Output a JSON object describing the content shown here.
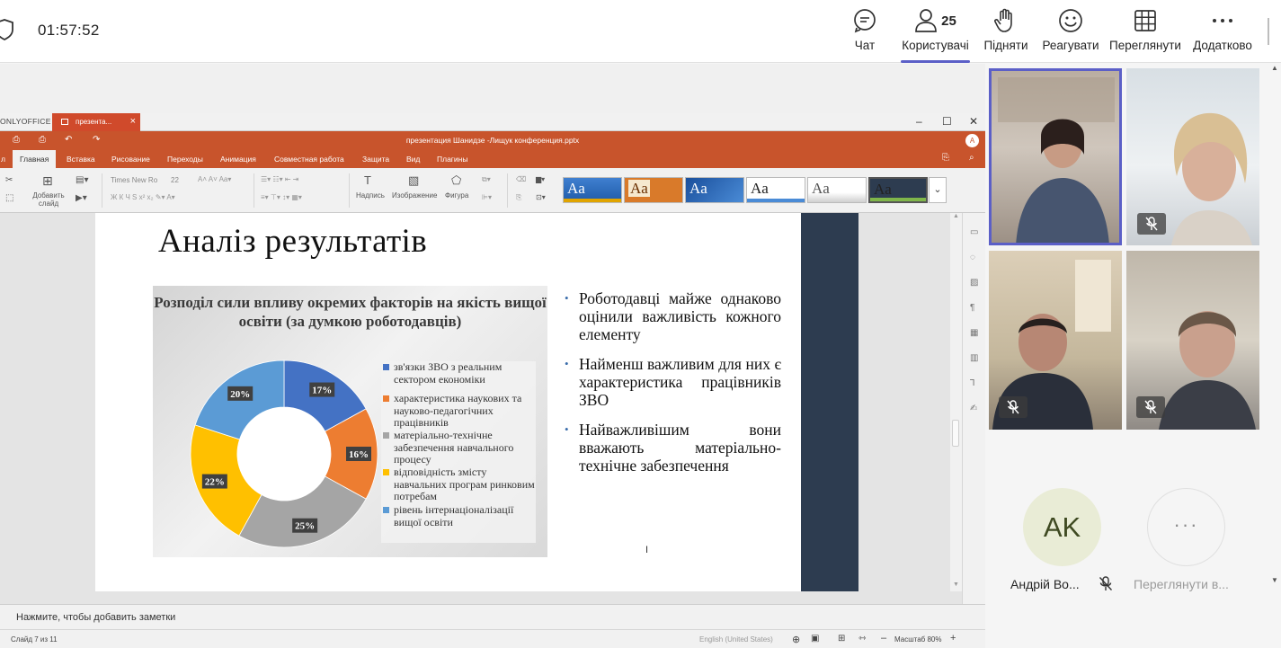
{
  "meeting": {
    "timer": "01:57:52",
    "participant_count": "25",
    "toolbar": [
      {
        "id": "chat",
        "label": "Чат",
        "icon": "chat-icon"
      },
      {
        "id": "people",
        "label": "Користувачі",
        "icon": "people-icon",
        "active": true
      },
      {
        "id": "raise",
        "label": "Підняти",
        "icon": "raise-hand-icon"
      },
      {
        "id": "react",
        "label": "Реагувати",
        "icon": "smile-icon"
      },
      {
        "id": "view",
        "label": "Переглянути",
        "icon": "grid-icon"
      },
      {
        "id": "more",
        "label": "Додатково",
        "icon": "more-icon"
      }
    ],
    "accent_color": "#5b5fc7"
  },
  "editor": {
    "brand": "ONLYOFFICE",
    "doc_tab": "презента...",
    "title": "презентация Шанидзе -Лищук конференция.pptx",
    "user_initial": "A",
    "menu": [
      "л",
      "Главная",
      "Вставка",
      "Рисование",
      "Переходы",
      "Анимация",
      "Совместная работа",
      "Защита",
      "Вид",
      "Плагины"
    ],
    "toolbar": {
      "add_slide": "Добавить слайд",
      "font_name": "Times New Ro",
      "font_size": "22",
      "textbox": "Надпись",
      "image": "Изображение",
      "shape": "Фигура"
    },
    "theme_sample": "Aa",
    "accent_color": "#c8542c",
    "notes_placeholder": "Нажмите, чтобы добавить заметки",
    "status": {
      "slide": "Слайд 7 из 11",
      "language": "English (United States)",
      "zoom": "Масштаб 80%"
    }
  },
  "slide": {
    "title": "Аналіз результатів",
    "bullets": [
      "Роботодавці майже однаково оцінили важливість кожного елементу",
      "Найменш важливим для них є характеристика працівників ЗВО",
      "Найважливішим вони вважають матеріально-технічне забезпечення"
    ]
  },
  "chart_data": {
    "type": "pie",
    "title": "Розподіл сили впливу окремих факторів на якість вищої освіти (за думкою роботодавців)",
    "categories": [
      "зв'язки ЗВО з реальним сектором економіки",
      "характеристика наукових та науково-педагогічних працівників",
      "матеріально-технічне забезпечення навчального процесу",
      "відповідність змісту навчальних програм ринковим потребам",
      "рівень інтернаціоналізації вищої освіти"
    ],
    "values": [
      17,
      16,
      25,
      22,
      20
    ],
    "labels": [
      "17%",
      "16%",
      "25%",
      "22%",
      "20%"
    ],
    "colors": [
      "#4472c4",
      "#ed7d31",
      "#a5a5a5",
      "#ffc000",
      "#5b9bd5"
    ],
    "donut": true,
    "legend": "right"
  },
  "participants": [
    {
      "id": "p1",
      "muted": false,
      "active_speaker": true
    },
    {
      "id": "p2",
      "muted": true
    },
    {
      "id": "p3",
      "muted": true
    },
    {
      "id": "p4",
      "muted": true
    }
  ],
  "roster": {
    "avatar_initials": "AK",
    "avatar_name": "Андрій Во...",
    "more_label": "Переглянути в...",
    "more_glyph": "···"
  }
}
